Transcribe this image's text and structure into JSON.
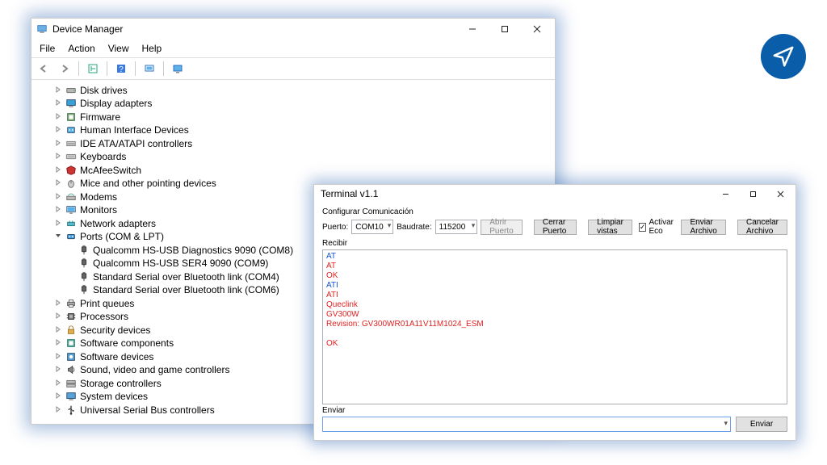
{
  "devmgr": {
    "title": "Device Manager",
    "menu": {
      "file": "File",
      "action": "Action",
      "view": "View",
      "help": "Help"
    },
    "tree": [
      {
        "icon": "disk",
        "label": "Disk drives"
      },
      {
        "icon": "display",
        "label": "Display adapters"
      },
      {
        "icon": "firmware",
        "label": "Firmware"
      },
      {
        "icon": "hid",
        "label": "Human Interface Devices"
      },
      {
        "icon": "ide",
        "label": "IDE ATA/ATAPI controllers"
      },
      {
        "icon": "keyboard",
        "label": "Keyboards"
      },
      {
        "icon": "mcafee",
        "label": "McAfeeSwitch"
      },
      {
        "icon": "mouse",
        "label": "Mice and other pointing devices"
      },
      {
        "icon": "modem",
        "label": "Modems"
      },
      {
        "icon": "monitor",
        "label": "Monitors"
      },
      {
        "icon": "network",
        "label": "Network adapters"
      },
      {
        "icon": "port",
        "label": "Ports (COM & LPT)",
        "expanded": true,
        "children": [
          {
            "icon": "plug",
            "label": "Qualcomm HS-USB Diagnostics 9090 (COM8)"
          },
          {
            "icon": "plug",
            "label": "Qualcomm HS-USB SER4 9090 (COM9)"
          },
          {
            "icon": "plug",
            "label": "Standard Serial over Bluetooth link (COM4)"
          },
          {
            "icon": "plug",
            "label": "Standard Serial over Bluetooth link (COM6)"
          }
        ]
      },
      {
        "icon": "print",
        "label": "Print queues"
      },
      {
        "icon": "cpu",
        "label": "Processors"
      },
      {
        "icon": "security",
        "label": "Security devices"
      },
      {
        "icon": "softcomp",
        "label": "Software components"
      },
      {
        "icon": "softdev",
        "label": "Software devices"
      },
      {
        "icon": "sound",
        "label": "Sound, video and game controllers"
      },
      {
        "icon": "storage",
        "label": "Storage controllers"
      },
      {
        "icon": "system",
        "label": "System devices"
      },
      {
        "icon": "usb",
        "label": "Universal Serial Bus controllers"
      }
    ]
  },
  "terminal": {
    "title": "Terminal v1.1",
    "config_label": "Configurar Comunicación",
    "puerto_label": "Puerto:",
    "puerto_value": "COM10",
    "baudrate_label": "Baudrate:",
    "baudrate_value": "115200",
    "btn_abrir": "Abrir Puerto",
    "btn_cerrar": "Cerrar Puerto",
    "btn_limpiar": "Limpiar vistas",
    "chk_eco": "Activar Eco",
    "btn_enviar_archivo": "Enviar Archivo",
    "btn_cancelar_archivo": "Cancelar Archivo",
    "recv_label": "Recibir",
    "recv_lines": [
      {
        "c": "blue",
        "t": "AT"
      },
      {
        "c": "red",
        "t": "AT"
      },
      {
        "c": "red",
        "t": "OK"
      },
      {
        "c": "blue",
        "t": "ATI"
      },
      {
        "c": "red",
        "t": "ATI"
      },
      {
        "c": "red",
        "t": "Queclink"
      },
      {
        "c": "red",
        "t": "GV300W"
      },
      {
        "c": "red",
        "t": "Revision: GV300WR01A11V11M1024_ESM"
      },
      {
        "c": "red",
        "t": ""
      },
      {
        "c": "red",
        "t": "OK"
      }
    ],
    "send_label": "Enviar",
    "btn_enviar": "Enviar"
  }
}
